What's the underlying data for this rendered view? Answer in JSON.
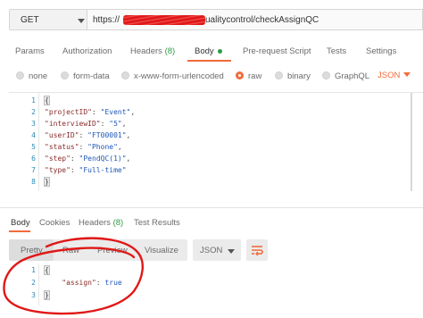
{
  "request": {
    "method": "GET",
    "url_prefix": "https://",
    "url_suffix": "ualitycontrol/checkAssignQC"
  },
  "request_tabs": [
    {
      "label": "Params"
    },
    {
      "label": "Authorization"
    },
    {
      "label": "Headers",
      "count": "(8)"
    },
    {
      "label": "Body",
      "active": true
    },
    {
      "label": "Pre-request Script"
    },
    {
      "label": "Tests"
    },
    {
      "label": "Settings"
    }
  ],
  "body_types": [
    {
      "label": "none"
    },
    {
      "label": "form-data"
    },
    {
      "label": "x-www-form-urlencoded"
    },
    {
      "label": "raw",
      "selected": true
    },
    {
      "label": "binary"
    },
    {
      "label": "GraphQL"
    }
  ],
  "body_format": "JSON",
  "request_body": {
    "line_numbers": [
      "1",
      "2",
      "3",
      "4",
      "5",
      "6",
      "7",
      "8"
    ],
    "open_brace": "{",
    "close_brace": "}",
    "fields": [
      {
        "key": "\"projectID\"",
        "value": "\"Event\""
      },
      {
        "key": "\"interviewID\"",
        "value": "\"5\""
      },
      {
        "key": "\"userID\"",
        "value": "\"FT00001\""
      },
      {
        "key": "\"status\"",
        "value": "\"Phone\""
      },
      {
        "key": "\"step\"",
        "value": "\"PendQC(1)\""
      },
      {
        "key": "\"type\"",
        "value": "\"Full-time\""
      }
    ]
  },
  "response_tabs": [
    {
      "label": "Body",
      "active": true
    },
    {
      "label": "Cookies"
    },
    {
      "label": "Headers",
      "count": "(8)"
    },
    {
      "label": "Test Results"
    }
  ],
  "response_views": [
    {
      "label": "Pretty",
      "active": true
    },
    {
      "label": "Raw"
    },
    {
      "label": "Preview"
    },
    {
      "label": "Visualize"
    }
  ],
  "response_format": "JSON",
  "response_body": {
    "line_numbers": [
      "1",
      "2",
      "3"
    ],
    "open_brace": "{",
    "close_brace": "}",
    "key": "\"assign\"",
    "value": "true"
  },
  "colors": {
    "accent": "#f26b3a",
    "green": "#2e9a45",
    "annotation": "#e01818",
    "redaction": "#e01818"
  },
  "icons": [
    "caret-down-icon",
    "radio-icon",
    "wrap-lines-icon"
  ]
}
